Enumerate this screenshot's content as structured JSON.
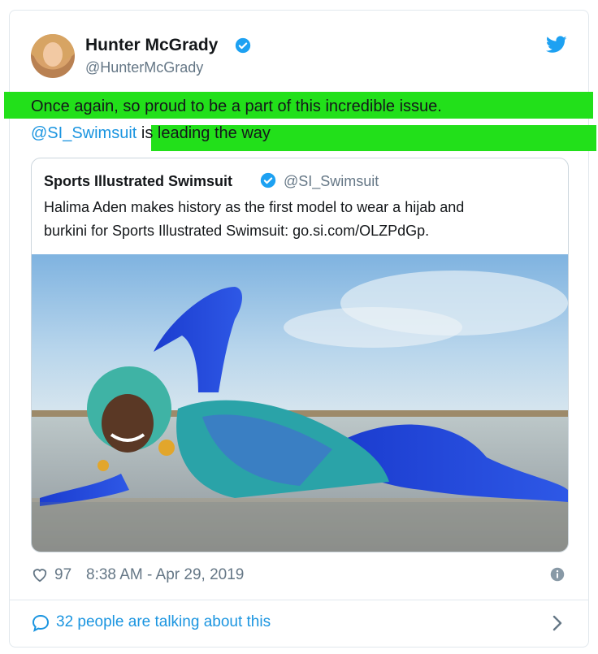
{
  "author": {
    "display_name": "Hunter McGrady",
    "handle": "@HunterMcGrady",
    "verified": true
  },
  "tweet": {
    "line1": "Once again, so proud to be a part of this incredible issue.",
    "mention": "@SI_Swimsuit",
    "line2_rest": " is leading the way"
  },
  "quoted": {
    "display_name": "Sports Illustrated Swimsuit",
    "handle": "@SI_Swimsuit",
    "text_line1": "Halima Aden makes history as the first model to wear a hijab and",
    "text_line2": "burkini for Sports Illustrated Swimsuit: go.si.com/OLZPdGp."
  },
  "footer": {
    "likes": "97",
    "timestamp": "8:38 AM - Apr 29, 2019",
    "talking": "32 people are talking about this"
  },
  "colors": {
    "highlight": "#22e01a",
    "link": "#1b95e0",
    "verified": "#1da1f2"
  },
  "icons": [
    "verified-badge-icon",
    "twitter-bird-icon",
    "heart-icon",
    "info-icon",
    "speech-bubble-icon",
    "chevron-right-icon"
  ]
}
